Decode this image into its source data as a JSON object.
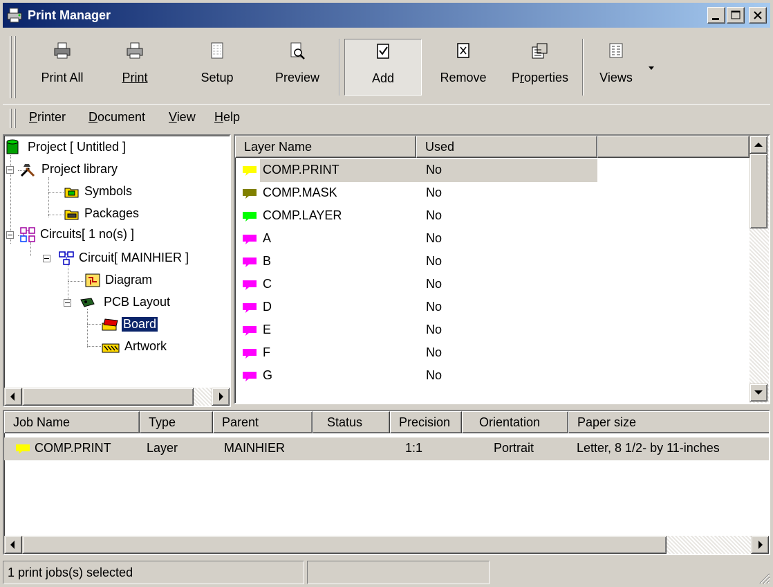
{
  "window": {
    "title": "Print Manager"
  },
  "toolbar": {
    "print_all": "Print All",
    "print": "Print",
    "setup": "Setup",
    "preview": "Preview",
    "add": "Add",
    "remove": "Remove",
    "properties": "Properties",
    "views": "Views"
  },
  "menu": {
    "printer": "Printer",
    "document": "Document",
    "view": "View",
    "help": "Help"
  },
  "tree": {
    "project": "Project [ Untitled ]",
    "project_library": "Project library",
    "symbols": "Symbols",
    "packages": "Packages",
    "circuits": "Circuits[ 1 no(s) ]",
    "circuit": "Circuit[ MAINHIER ]",
    "diagram": "Diagram",
    "pcb_layout": "PCB Layout",
    "board": "Board",
    "artwork": "Artwork"
  },
  "layers": {
    "headers": {
      "name": "Layer Name",
      "used": "Used"
    },
    "rows": [
      {
        "name": "COMP.PRINT",
        "used": "No",
        "color": "#ffff00"
      },
      {
        "name": "COMP.MASK",
        "used": "No",
        "color": "#808000"
      },
      {
        "name": "COMP.LAYER",
        "used": "No",
        "color": "#00ff00"
      },
      {
        "name": "A",
        "used": "No",
        "color": "#ff00ff"
      },
      {
        "name": "B",
        "used": "No",
        "color": "#ff00ff"
      },
      {
        "name": "C",
        "used": "No",
        "color": "#ff00ff"
      },
      {
        "name": "D",
        "used": "No",
        "color": "#ff00ff"
      },
      {
        "name": "E",
        "used": "No",
        "color": "#ff00ff"
      },
      {
        "name": "F",
        "used": "No",
        "color": "#ff00ff"
      },
      {
        "name": "G",
        "used": "No",
        "color": "#ff00ff"
      }
    ]
  },
  "jobs": {
    "headers": {
      "job_name": "Job Name",
      "type": "Type",
      "parent": "Parent",
      "status": "Status",
      "precision": "Precision",
      "orientation": "Orientation",
      "paper_size": "Paper size"
    },
    "rows": [
      {
        "job_name": "COMP.PRINT",
        "type": "Layer",
        "parent": "MAINHIER",
        "status": "",
        "precision": "1:1",
        "orientation": "Portrait",
        "paper_size": "Letter, 8 1/2- by 11-inches",
        "color": "#ffff00"
      }
    ]
  },
  "status": {
    "text": "1 print jobs(s) selected",
    "panel2": ""
  },
  "colors": {
    "title_start": "#0a246a",
    "title_end": "#a6caf0",
    "selection": "#0a246a",
    "face": "#d4d0c8"
  }
}
